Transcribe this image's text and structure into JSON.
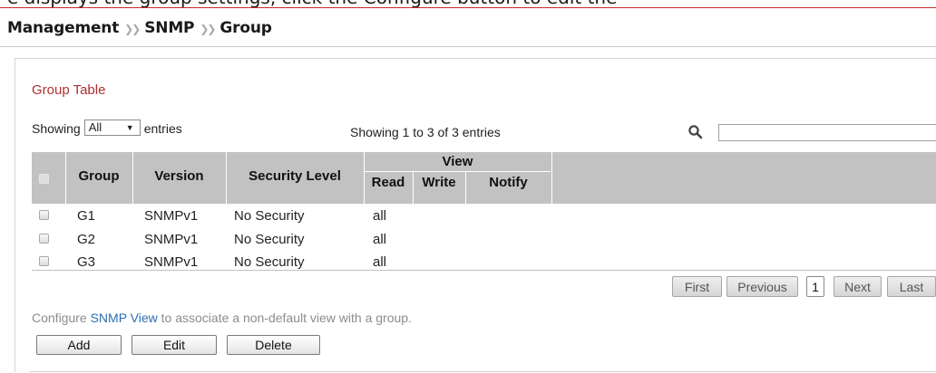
{
  "clipped_header": "e displays the group settings, click the Configure button to edit the",
  "breadcrumb": {
    "items": [
      "Management",
      "SNMP",
      "Group"
    ],
    "separator": "❯❯"
  },
  "section_title": "Group Table",
  "showing": {
    "prefix": "Showing",
    "value": "All",
    "suffix": "entries"
  },
  "entries_info": "Showing 1 to 3 of 3 entries",
  "search": {
    "placeholder": "",
    "icon": "search-icon"
  },
  "table": {
    "headers": {
      "group": "Group",
      "version": "Version",
      "security": "Security Level",
      "view": "View",
      "read": "Read",
      "write": "Write",
      "notify": "Notify"
    },
    "rows": [
      {
        "group": "G1",
        "version": "SNMPv1",
        "security": "No Security",
        "read": "all",
        "write": "",
        "notify": ""
      },
      {
        "group": "G2",
        "version": "SNMPv1",
        "security": "No Security",
        "read": "all",
        "write": "",
        "notify": ""
      },
      {
        "group": "G3",
        "version": "SNMPv1",
        "security": "No Security",
        "read": "all",
        "write": "",
        "notify": ""
      }
    ]
  },
  "pagination": {
    "first": "First",
    "previous": "Previous",
    "current": "1",
    "next": "Next",
    "last": "Last"
  },
  "note": {
    "before": "Configure ",
    "link": "SNMP View",
    "after": " to associate a non-default view with a group."
  },
  "buttons": {
    "add": "Add",
    "edit": "Edit",
    "delete": "Delete"
  },
  "colors": {
    "title_red": "#b03030",
    "link_blue": "#2a6fb3",
    "header_gray": "#c2c2c2"
  }
}
